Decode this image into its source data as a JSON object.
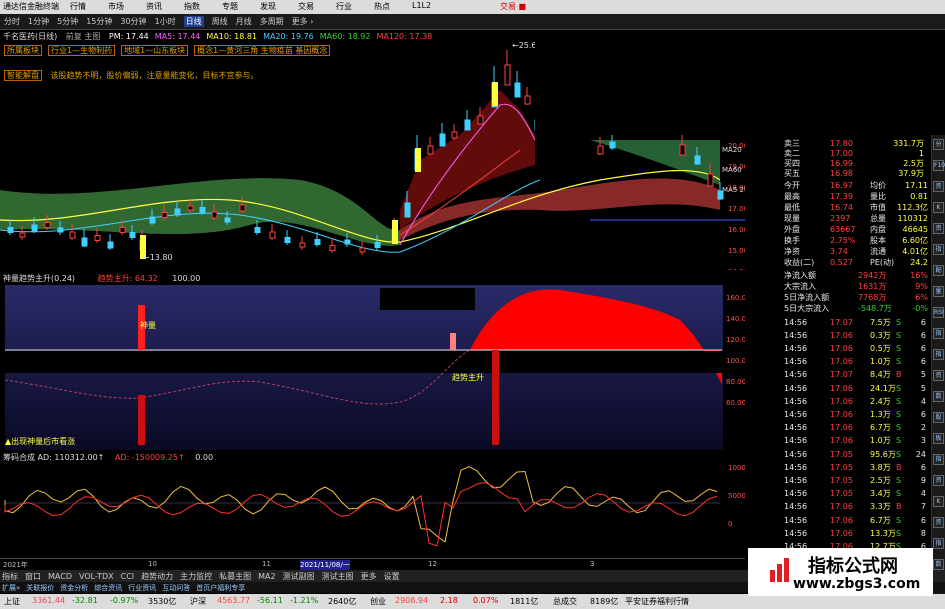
{
  "window": {
    "title": "通达信金融终端",
    "menu": [
      "行情",
      "市场",
      "资讯",
      "指数",
      "专题",
      "发现",
      "交易",
      "行业",
      "热点",
      "L1L2"
    ],
    "right_text": "交易 ■"
  },
  "toolbar": {
    "items": [
      "分时",
      "1分钟",
      "5分钟",
      "15分钟",
      "30分钟",
      "1小时",
      "日线",
      "周线",
      "月线",
      "多周期",
      "更多 ›"
    ],
    "active": "日线"
  },
  "main": {
    "stock_title": "千名医药(日线)",
    "chart_label": "前复 主图",
    "ma": [
      {
        "label": "PM: 17.44",
        "color": "#ffffff"
      },
      {
        "label": "MA5: 17.44",
        "color": "#ff60ff"
      },
      {
        "label": "MA10: 18.81",
        "color": "#ffff40"
      },
      {
        "label": "MA20: 19.76",
        "color": "#40d0ff"
      },
      {
        "label": "MA60: 18.92",
        "color": "#30d030"
      },
      {
        "label": "MA120: 17.38",
        "color": "#ff4040"
      }
    ],
    "info1": [
      "所属板块",
      "行业1—生物制药",
      "地域1—山东板块",
      "概念1—黄河三角 生物疫苗 基因概念"
    ],
    "info2_tag": "智能解盘",
    "info2_text": "该股趋势不明，股价偏弱，注意量能变化，目标不宜参与。",
    "price_labels": [
      "20.00",
      "19.00",
      "18.00",
      "17.00",
      "16.00",
      "15.00",
      "14.00"
    ],
    "high_label": "25.68",
    "low_label": "13.80",
    "ma_right": [
      "MA20",
      "MA60",
      "MA5 20"
    ]
  },
  "osc": {
    "title": "神量趋势主升(0.24)",
    "title2": "趋势主升: 64.32",
    "title3": "100.00",
    "labels": [
      "160.00",
      "140.00",
      "120.00",
      "100.00",
      "80.00",
      "60.00"
    ],
    "mark1": "神量",
    "mark2": "趋势主升",
    "bottom_text": "▲出现神量后市看涨"
  },
  "vol": {
    "title": "筹码合成 AD: 110312.00↑",
    "title2": "AD: -150009.25↑",
    "title3": "0.00",
    "labels": [
      "10000",
      "5000",
      "0"
    ]
  },
  "time_axis": [
    "2021年",
    "10",
    "11",
    "2021/11/08/一",
    "12",
    "3"
  ],
  "right": {
    "top": [
      {
        "l": "卖三",
        "p": "17.80",
        "v": "331.7万"
      },
      {
        "l": "卖二",
        "p": "17.00",
        "v": "1"
      },
      {
        "l": "买四",
        "p": "16.99",
        "v": "2.5万"
      },
      {
        "l": "买五",
        "p": "16.98",
        "v": "37.9万"
      }
    ],
    "stats": [
      [
        "今开",
        "16.97",
        "均价",
        "17.11"
      ],
      [
        "最高",
        "17.39",
        "量比",
        "0.81"
      ],
      [
        "最低",
        "16.74",
        "市值",
        "112.3亿"
      ],
      [
        "现量",
        "2397",
        "总量",
        "110312"
      ],
      [
        "外盘",
        "63667",
        "内盘",
        "46645"
      ],
      [
        "换手",
        "2.75%",
        "股本",
        "6.60亿"
      ],
      [
        "净资",
        "3.74",
        "流通",
        "4.01亿"
      ],
      [
        "收益(二)",
        "0.527",
        "PE(动)",
        "24.2"
      ]
    ],
    "flows": [
      {
        "l": "净流入额",
        "v": "2942万",
        "p": "16%"
      },
      {
        "l": "大宗流入",
        "v": "1631万",
        "p": "9%"
      },
      {
        "l": "5日净流入额",
        "v": "7768万",
        "p": "6%"
      },
      {
        "l": "5日大宗流入",
        "v": "-548.7万",
        "p": "-0%"
      }
    ],
    "ticks": [
      [
        "14:56",
        "17.07",
        "7.5万",
        "S",
        "6"
      ],
      [
        "14:56",
        "17.06",
        "0.3万",
        "S",
        "6"
      ],
      [
        "14:56",
        "17.06",
        "0.5万",
        "S",
        "6"
      ],
      [
        "14:56",
        "17.06",
        "1.0万",
        "S",
        "6"
      ],
      [
        "14:56",
        "17.07",
        "8.4万",
        "B",
        "5"
      ],
      [
        "14:56",
        "17.06",
        "24.1万",
        "S",
        "5"
      ],
      [
        "14:56",
        "17.06",
        "2.4万",
        "S",
        "4"
      ],
      [
        "14:56",
        "17.06",
        "1.3万",
        "S",
        "6"
      ],
      [
        "14:56",
        "17.06",
        "6.7万",
        "S",
        "2"
      ],
      [
        "14:56",
        "17.06",
        "1.0万",
        "S",
        "3"
      ],
      [
        "14:56",
        "17.05",
        "95.6万",
        "S",
        "24"
      ],
      [
        "14:56",
        "17.05",
        "3.8万",
        "B",
        "6"
      ],
      [
        "14:56",
        "17.05",
        "2.5万",
        "S",
        "9"
      ],
      [
        "14:56",
        "17.05",
        "3.4万",
        "S",
        "4"
      ],
      [
        "14:56",
        "17.06",
        "3.3万",
        "B",
        "7"
      ],
      [
        "14:56",
        "17.06",
        "6.7万",
        "S",
        "6"
      ],
      [
        "14:56",
        "17.06",
        "13.3万",
        "S",
        "8"
      ],
      [
        "14:56",
        "17.06",
        "12.7万",
        "S",
        "6"
      ]
    ]
  },
  "tabs": [
    "指标",
    "窗口",
    "MACD",
    "VOL-TDX",
    "CCI",
    "趋势动力",
    "主力监控",
    "私募主图",
    "MA2",
    "测试副图",
    "测试主图",
    "更多",
    "设置"
  ],
  "subtabs": [
    "扩展»",
    "关联报价",
    "资金分析",
    "综合资讯",
    "行业资讯",
    "互动问答",
    "首页户福利专享"
  ],
  "status": {
    "sh_label": "上证",
    "sh": "3361.44",
    "sh_chg": "-32.81",
    "sh_pct": "-0.97%",
    "sh_amt": "3530亿",
    "sz_label": "沪深",
    "sz": "4563.77",
    "sz_chg": "-56.11",
    "sz_pct": "-1.21%",
    "sz_amt": "2640亿",
    "cy_label": "创业",
    "cy": "2908.94",
    "cy_chg": "2.18",
    "cy_pct": "0.07%",
    "cy_amt": "1811亿",
    "total_label": "总成交",
    "total": "8189亿",
    "broker": "平安证券福利行情"
  },
  "watermark": {
    "line1": "指标公式网",
    "line2": "www.zbgs3.com"
  },
  "sidebar_icons": [
    "分",
    "F10",
    "资",
    "K",
    "资",
    "指",
    "配",
    "量",
    "RSI",
    "指",
    "指",
    "资",
    "数",
    "股",
    "板",
    "指",
    "资",
    "K",
    "资",
    "指",
    "数"
  ]
}
